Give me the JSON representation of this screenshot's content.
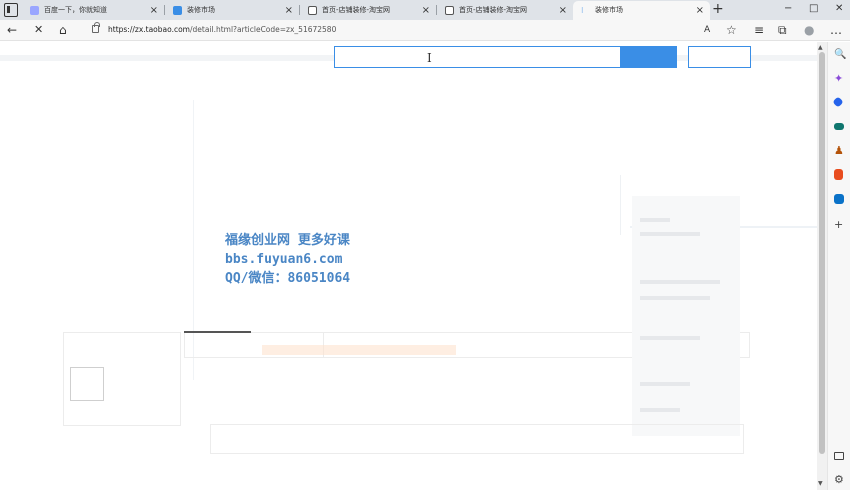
{
  "browser": {
    "tabs": [
      {
        "title": "百度一下，你就知道",
        "favicon_color": "#9aa6ff",
        "active": false
      },
      {
        "title": "装修市场",
        "favicon_color": "#3a8ee6",
        "active": false
      },
      {
        "title": "首页-店铺装修-淘宝网",
        "favicon_color": "#ffffff",
        "active": false
      },
      {
        "title": "首页-店铺装修-淘宝网",
        "favicon_color": "#ffffff",
        "active": false
      },
      {
        "title": "装修市场",
        "favicon_color": "#3a8ee6",
        "active": true
      }
    ],
    "new_tab_label": "+",
    "address": {
      "host": "https://zx.taobao.com",
      "path": "/detail.html?articleCode=zx_51672580"
    },
    "window_controls": {
      "minimize": "−",
      "maximize": "□",
      "close": "✕"
    },
    "nav_icons": [
      "back-arrow-icon",
      "stop-icon",
      "home-icon",
      "lock-icon"
    ],
    "toolbar_icons": [
      "read-aloud-icon",
      "favorite-add-icon",
      "favorites-icon",
      "collections-icon",
      "profile-icon",
      "more-icon"
    ]
  },
  "toolbar_glyphs": {
    "back": "←",
    "stop": "✕",
    "home": "⌂",
    "read_aloud": "A",
    "favorite_add": "☆",
    "favorites": "≡",
    "collections": "⧉",
    "profile": "●",
    "more": "…"
  },
  "page": {
    "watermark_lines": [
      "福缘创业网 更多好课",
      "bbs.fuyuan6.com",
      "QQ/微信：86051064"
    ]
  },
  "sidebar": {
    "glyphs": {
      "search": "🔍",
      "add": "+"
    },
    "icons": [
      "search-icon",
      "sparkle-icon",
      "tag-icon",
      "briefcase-icon",
      "games-icon",
      "office-icon",
      "outlook-icon",
      "add-icon",
      "sidebar-toggle-icon",
      "settings-icon"
    ],
    "colors": {
      "sparkle": "#8a4bd8",
      "tag": "#2563eb",
      "briefcase": "#0f766e",
      "games": "#b45309",
      "office": "#e84c1e",
      "outlook": "#0a72c8"
    }
  },
  "colors": {
    "accent": "#3a8ee6",
    "watermark": "#4a86c5"
  }
}
